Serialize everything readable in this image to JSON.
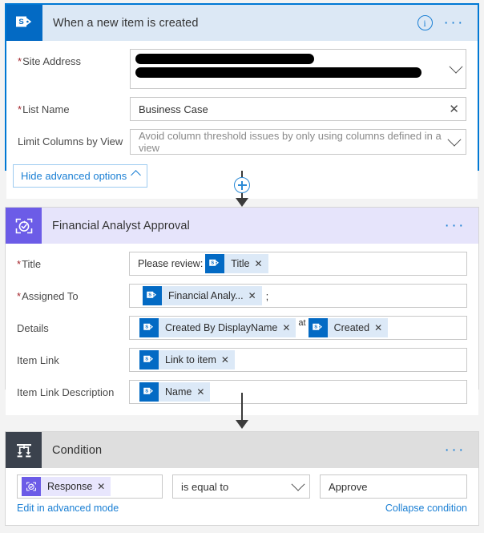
{
  "flow": {
    "trigger_card": {
      "icon": "sharepoint-icon",
      "title": "When a new item is created",
      "header_bg": "#dce8f5",
      "icon_bg": "#036ac4",
      "selected_border": "#0078d4",
      "info_label": "i",
      "menu_label": "···",
      "fields": [
        {
          "label": "Site Address",
          "required": true,
          "value": "",
          "redacted": true,
          "affordance": "chevron-down-icon"
        },
        {
          "label": "List Name",
          "required": true,
          "value": "Business Case",
          "redacted": false,
          "affordance": "clear-x-icon"
        },
        {
          "label": "Limit Columns by View",
          "required": false,
          "value": "Avoid column threshold issues by only using columns defined in a view",
          "placeholder": true,
          "redacted": false,
          "affordance": "chevron-down-icon"
        }
      ],
      "advanced_button": "Hide advanced options"
    },
    "approval_card": {
      "icon": "approvals-icon",
      "title": "Financial Analyst Approval",
      "header_bg": "#e6e4fb",
      "icon_bg": "#6c5ce7",
      "menu_label": "···",
      "fields": [
        {
          "label": "Title",
          "required": true,
          "prefix_text": "Please review:",
          "tokens": [
            {
              "text": "Title",
              "icon": "sharepoint-icon",
              "style": "blue"
            }
          ],
          "suffix_text": ""
        },
        {
          "label": "Assigned To",
          "required": true,
          "prefix_text": "",
          "tokens": [
            {
              "text": "Financial Analy...",
              "icon": "sharepoint-icon",
              "style": "blue"
            }
          ],
          "suffix_text": ";"
        },
        {
          "label": "Details",
          "required": false,
          "prefix_text": "",
          "tokens": [
            {
              "text": "Created By DisplayName",
              "icon": "sharepoint-icon",
              "style": "blue"
            },
            {
              "text": "Created",
              "icon": "sharepoint-icon",
              "style": "blue"
            }
          ],
          "between_text": "at",
          "suffix_text": ""
        },
        {
          "label": "Item Link",
          "required": false,
          "prefix_text": "",
          "tokens": [
            {
              "text": "Link to item",
              "icon": "sharepoint-icon",
              "style": "blue"
            }
          ],
          "suffix_text": ""
        },
        {
          "label": "Item Link Description",
          "required": false,
          "prefix_text": "",
          "tokens": [
            {
              "text": "Name",
              "icon": "sharepoint-icon",
              "style": "blue"
            }
          ],
          "suffix_text": ""
        }
      ]
    },
    "condition_card": {
      "icon": "condition-icon",
      "title": "Condition",
      "header_bg": "#dedede",
      "icon_bg": "#3b424d",
      "menu_label": "···",
      "left_token": {
        "text": "Response",
        "icon": "approvals-icon",
        "style": "purple"
      },
      "operator": "is equal to",
      "operator_affordance": "chevron-down-icon",
      "value": "Approve",
      "advanced_link": "Edit in advanced mode",
      "collapse_link": "Collapse condition"
    },
    "connectors": [
      {
        "name": "add-step-connector",
        "has_plus": true,
        "plus_label": "+"
      },
      {
        "name": "step-connector",
        "has_plus": false
      }
    ]
  }
}
